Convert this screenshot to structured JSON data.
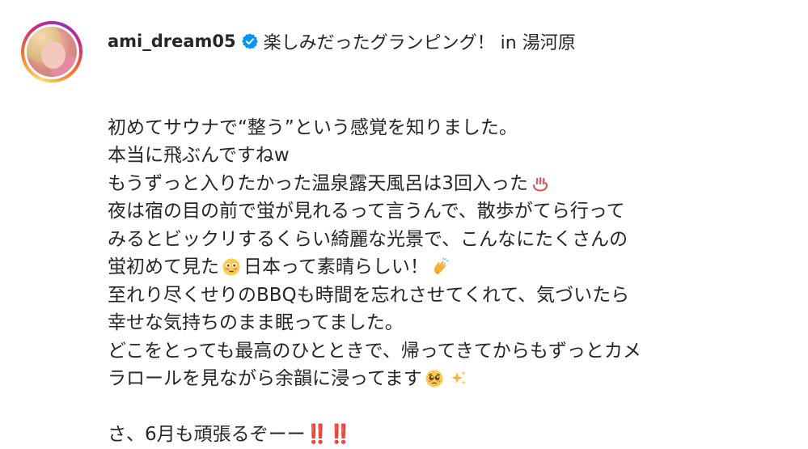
{
  "post": {
    "username": "ami_dream05",
    "title": "楽しみだったグランピング！ in 湯河原",
    "caption": {
      "line1": "初めてサウナで“整う”という感覚を知りました。",
      "line2": "本当に飛ぶんですねw",
      "line3": "もうずっと入りたかった温泉露天風呂は3回入った",
      "line4": "夜は宿の目の前で蛍が見れるって言うんで、散歩がてら行って",
      "line5": "みるとビックリするくらい綺麗な光景で、こんなにたくさんの",
      "line6a": "蛍初めて見た",
      "line6b": "日本って素晴らしい！",
      "line7": "至れり尽くせりのBBQも時間を忘れさせてくれて、気づいたら",
      "line8": "幸せな気持ちのまま眠ってました。",
      "line9": "どこをとっても最高のひとときで、帰ってきてからもずっとカメ",
      "line10": "ラロールを見ながら余韻に浸ってます",
      "line11": "さ、6月も頑張るぞーー‼️‼️"
    }
  },
  "colors": {
    "text": "#262626",
    "verified_blue": "#0095f6",
    "ring_gradient": [
      "#feda75",
      "#fa7e1e",
      "#d62976",
      "#962fbf"
    ]
  },
  "icons": {
    "verified": "verified-badge-icon",
    "hot_springs": "hot-springs-emoji",
    "flushed": "flushed-face-emoji",
    "clapping": "clapping-hands-emoji",
    "pleading": "pleading-face-emoji",
    "sparkles": "sparkles-emoji"
  }
}
